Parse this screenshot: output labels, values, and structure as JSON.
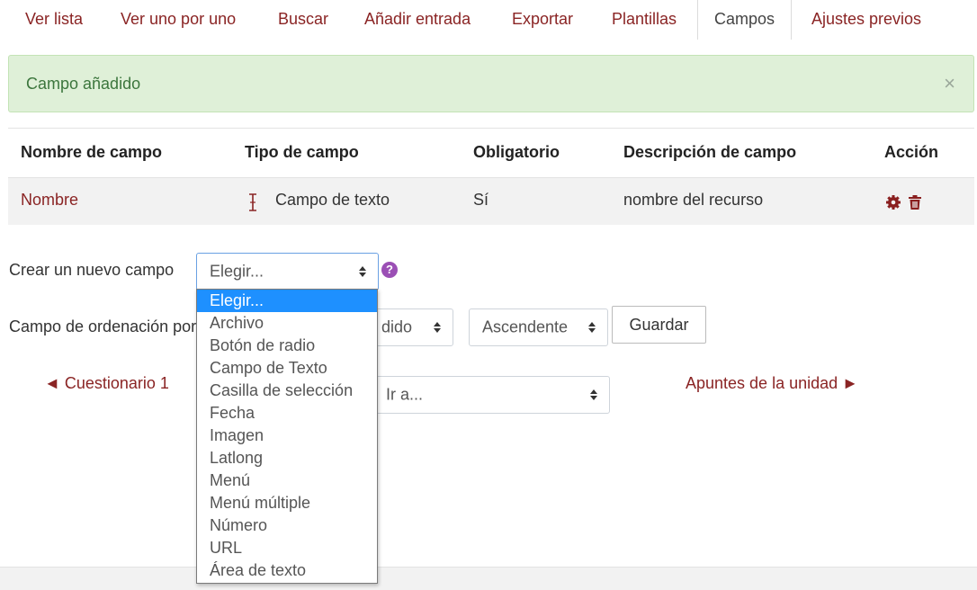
{
  "tabs": [
    {
      "label": "Ver lista"
    },
    {
      "label": "Ver uno por uno"
    },
    {
      "label": "Buscar"
    },
    {
      "label": "Añadir entrada"
    },
    {
      "label": "Exportar"
    },
    {
      "label": "Plantillas"
    },
    {
      "label": "Campos",
      "active": true
    },
    {
      "label": "Ajustes previos"
    }
  ],
  "alert": {
    "message": "Campo añadido",
    "close": "×"
  },
  "table": {
    "headers": [
      "Nombre de campo",
      "Tipo de campo",
      "Obligatorio",
      "Descripción de campo",
      "Acción"
    ],
    "rows": [
      {
        "name": "Nombre",
        "type_icon": "text-cursor-icon",
        "type": "Campo de texto",
        "required": "Sí",
        "description": "nombre del recurso",
        "actions": [
          "gear-icon",
          "trash-icon"
        ]
      }
    ]
  },
  "create_field": {
    "label": "Crear un nuevo campo",
    "selected": "Elegir...",
    "help": "?",
    "options": [
      "Elegir...",
      "Archivo",
      "Botón de radio",
      "Campo de Texto",
      "Casilla de selección",
      "Fecha",
      "Imagen",
      "Latlong",
      "Menú",
      "Menú múltiple",
      "Número",
      "URL",
      "Área de texto"
    ]
  },
  "sort": {
    "label": "Campo de ordenación por",
    "field_value": "dido",
    "order_value": "Ascendente",
    "save_label": "Guardar"
  },
  "navigation": {
    "prev": "◄ Cuestionario 1",
    "jump_placeholder": "Ir a...",
    "next": "Apuntes de la unidad ►"
  },
  "colors": {
    "accent": "#8a2424",
    "alert_bg": "#dff0d8",
    "alert_text": "#3c763d",
    "selected_option": "#1e90ff",
    "help": "#9b4fb5"
  }
}
